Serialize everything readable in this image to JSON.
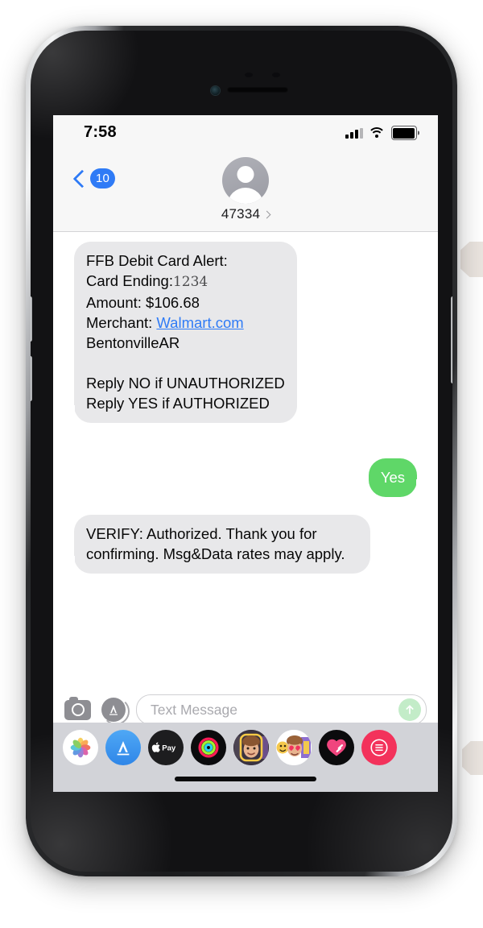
{
  "device": {
    "name": "iphone-mockup",
    "hardware": [
      "front-camera",
      "earpiece-speaker",
      "proximity-sensor",
      "power-button",
      "volume-buttons"
    ]
  },
  "status_bar": {
    "time": "7:58",
    "signal_bars_filled": 3,
    "signal_bars_total": 4,
    "wifi": "full",
    "battery": "full",
    "icons": [
      "cellular-signal-icon",
      "wifi-icon",
      "battery-icon"
    ]
  },
  "nav_bar": {
    "back_badge": "10",
    "back_icon": "chevron-left-icon",
    "contact_name": "47334",
    "contact_chevron": "chevron-right-icon",
    "avatar": "default-person-avatar"
  },
  "conversation": {
    "messages": [
      {
        "id": "msg-alert",
        "side": "in",
        "line1": "FFB Debit Card Alert:",
        "line2_label": "Card Ending:",
        "line2_value": "1234",
        "line3": "Amount: $106.68",
        "line4_label": "Merchant:",
        "line4_link": "Walmart.com",
        "line5": "BentonvilleAR",
        "line6": "Reply NO if UNAUTHORIZED",
        "line7": "Reply YES if AUTHORIZED"
      },
      {
        "id": "msg-reply",
        "side": "out",
        "text": "Yes"
      },
      {
        "id": "msg-verify",
        "side": "in",
        "text": "VERIFY: Authorized. Thank you for confirming. Msg&Data rates may apply."
      }
    ]
  },
  "input_bar": {
    "camera_icon": "camera-icon",
    "appstore_icon": "app-store-icon",
    "placeholder": "Text Message",
    "send_icon": "send-arrow-up-icon"
  },
  "app_drawer": {
    "apps": [
      {
        "name": "photos",
        "label": "Photos"
      },
      {
        "name": "app-store",
        "label": "App Store"
      },
      {
        "name": "apple-pay",
        "label": "Pay"
      },
      {
        "name": "fitness-rings",
        "label": "Activity"
      },
      {
        "name": "memoji",
        "label": "Memoji"
      },
      {
        "name": "memoji-stickers",
        "label": "Memoji Stickers"
      },
      {
        "name": "digital-touch-heart",
        "label": "Digital Touch"
      },
      {
        "name": "music",
        "label": "Music"
      }
    ],
    "home_indicator": "home-indicator-bar"
  },
  "colors": {
    "accent_blue": "#2f7bf6",
    "outgoing_green": "#5fd768",
    "incoming_gray": "#e8e8ea",
    "drawer_gray": "#d2d3d8",
    "link_blue": "#2f7bf6"
  }
}
